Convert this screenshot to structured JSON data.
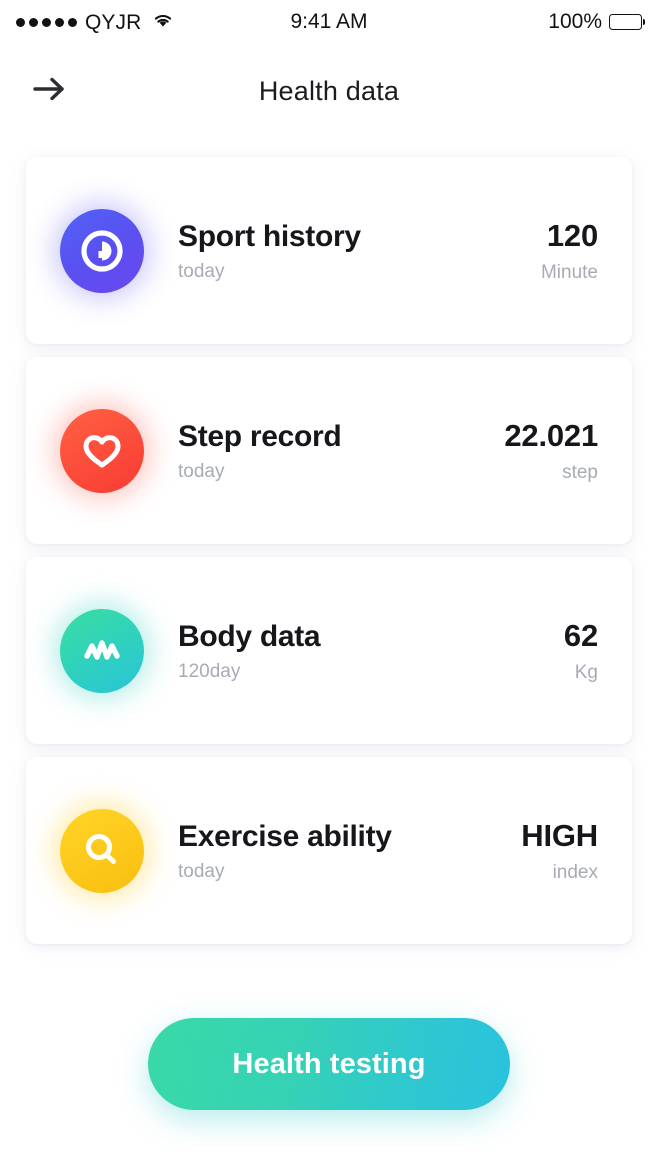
{
  "status_bar": {
    "signal_dots": 5,
    "carrier": "QYJR",
    "wifi_icon": "wifi-icon",
    "time": "9:41 AM",
    "battery_percent": "100%",
    "battery_icon": "battery-icon"
  },
  "header": {
    "back_icon": "arrow-right-icon",
    "title": "Health data"
  },
  "cards": [
    {
      "icon": "stopwatch-icon",
      "icon_class": "icon-sport",
      "icon_color": "#5b4ff0",
      "title": "Sport history",
      "subtitle": "today",
      "value": "120",
      "unit": "Minute"
    },
    {
      "icon": "heart-icon",
      "icon_class": "icon-step",
      "icon_color": "#fb4a3a",
      "title": "Step record",
      "subtitle": "today",
      "value": "22.021",
      "unit": "step"
    },
    {
      "icon": "pulse-wave-icon",
      "icon_class": "icon-body",
      "icon_color": "#2fd0c0",
      "title": "Body data",
      "subtitle": "120day",
      "value": "62",
      "unit": "Kg"
    },
    {
      "icon": "magnifier-icon",
      "icon_class": "icon-exercise",
      "icon_color": "#fcc81a",
      "title": "Exercise ability",
      "subtitle": "today",
      "value": "HIGH",
      "unit": "index"
    }
  ],
  "cta": {
    "label": "Health testing",
    "gradient_from": "#3ad9a7",
    "gradient_to": "#2ac2dd"
  }
}
